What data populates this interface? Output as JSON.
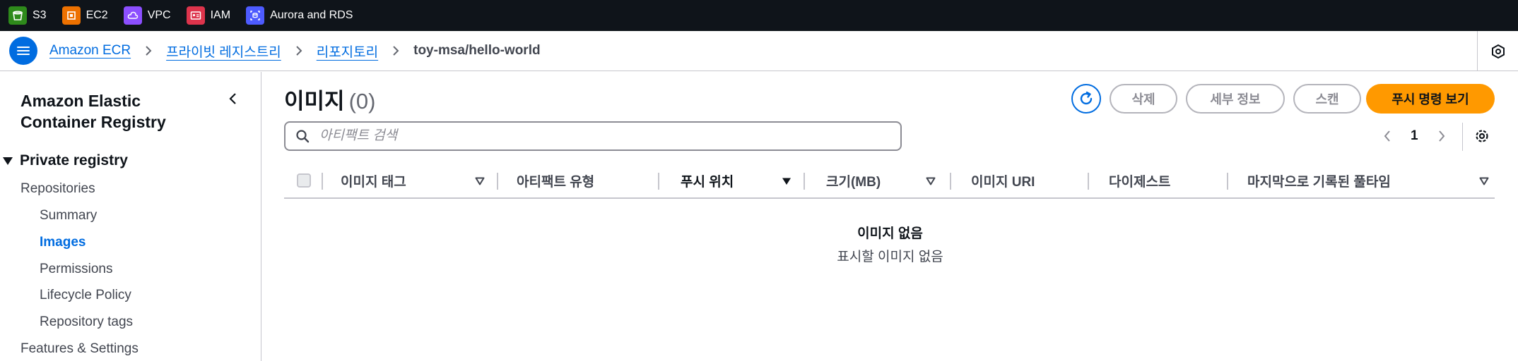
{
  "favorites": [
    {
      "label": "S3",
      "icon": "s3-bucket-icon",
      "color": "#2e8a1b"
    },
    {
      "label": "EC2",
      "icon": "ec2-chip-icon",
      "color": "#ed7100"
    },
    {
      "label": "VPC",
      "icon": "vpc-cloud-icon",
      "color": "#8c4fff"
    },
    {
      "label": "IAM",
      "icon": "iam-id-card-icon",
      "color": "#dd344c"
    },
    {
      "label": "Aurora and RDS",
      "icon": "rds-database-icon",
      "color": "#4d5bff"
    }
  ],
  "breadcrumb": {
    "items": [
      "Amazon ECR",
      "프라이빗 레지스트리",
      "리포지토리"
    ],
    "current": "toy-msa/hello-world"
  },
  "sidenav": {
    "title": "Amazon Elastic Container Registry",
    "section": "Private registry",
    "items": [
      "Repositories",
      "Summary",
      "Images",
      "Permissions",
      "Lifecycle Policy",
      "Repository tags",
      "Features & Settings"
    ],
    "active": "Images"
  },
  "main": {
    "title": "이미지",
    "count": "(0)",
    "buttons": {
      "delete": "삭제",
      "details": "세부 정보",
      "scan": "스캔",
      "push": "푸시 명령 보기"
    },
    "search_placeholder": "아티팩트 검색",
    "page": "1",
    "columns": [
      "이미지 태그",
      "아티팩트 유형",
      "푸시 위치",
      "크기(MB)",
      "이미지 URI",
      "다이제스트",
      "마지막으로 기록된 풀타임"
    ],
    "empty_title": "이미지 없음",
    "empty_sub": "표시할 이미지 없음"
  },
  "colors": {
    "accent": "#006ce0",
    "primary_button": "#ff9900",
    "topbar": "#0f141a"
  }
}
